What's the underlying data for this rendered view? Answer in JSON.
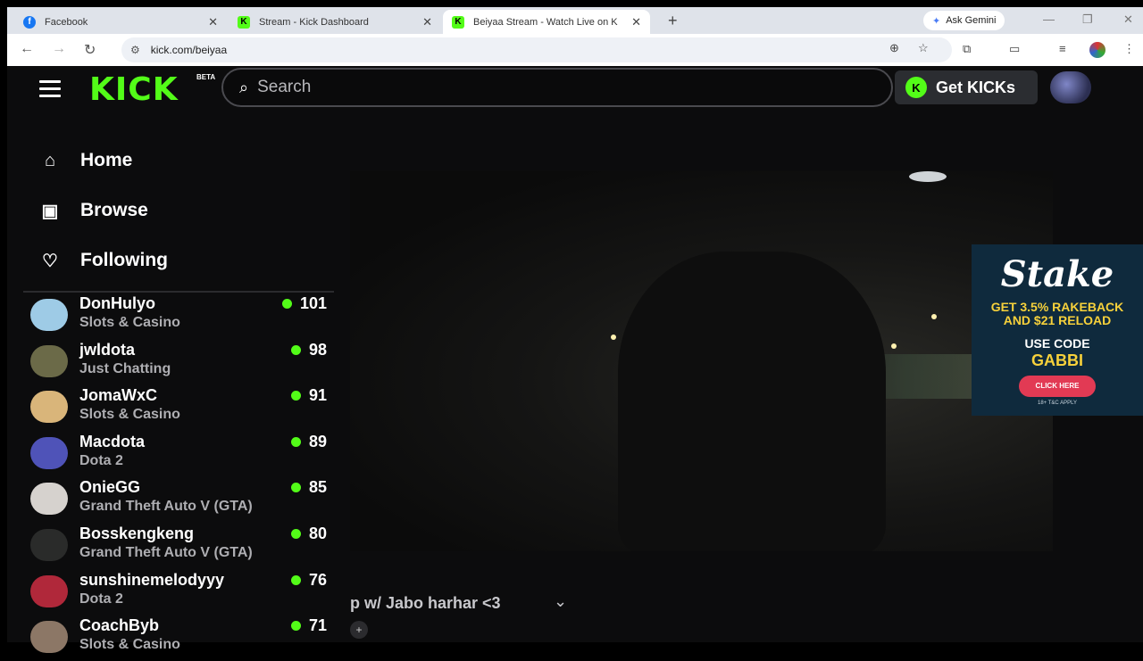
{
  "browser": {
    "tabs": [
      {
        "title": "Facebook",
        "favicon": "facebook-icon",
        "active": false
      },
      {
        "title": "Stream - Kick Dashboard",
        "favicon": "kick-icon",
        "active": false
      },
      {
        "title": "Beiyaa Stream - Watch Live on K",
        "favicon": "kick-icon",
        "active": true
      }
    ],
    "new_tab": "+",
    "gemini_label": "Ask Gemini",
    "url": "kick.com/beiyaa"
  },
  "kick": {
    "logo": "KICK",
    "beta": "BETA",
    "search_placeholder": "Search",
    "get_kicks": "Get KICKs",
    "nav": [
      {
        "label": "Home",
        "icon": "home-icon"
      },
      {
        "label": "Browse",
        "icon": "browse-icon"
      },
      {
        "label": "Following",
        "icon": "heart-icon"
      }
    ],
    "following": [
      {
        "name": "DonHulyo",
        "category": "Slots & Casino",
        "viewers": "101",
        "avatar_color": "#9ecbe6"
      },
      {
        "name": "jwldota",
        "category": "Just Chatting",
        "viewers": "98",
        "avatar_color": "#6b6a48"
      },
      {
        "name": "JomaWxC",
        "category": "Slots & Casino",
        "viewers": "91",
        "avatar_color": "#d9b57a"
      },
      {
        "name": "Macdota",
        "category": "Dota 2",
        "viewers": "89",
        "avatar_color": "#4f53b8"
      },
      {
        "name": "OnieGG",
        "category": "Grand Theft Auto V (GTA)",
        "viewers": "85",
        "avatar_color": "#d6d2ce"
      },
      {
        "name": "Bosskengkeng",
        "category": "Grand Theft Auto V (GTA)",
        "viewers": "80",
        "avatar_color": "#2a2b2a"
      },
      {
        "name": "sunshinemelodyyy",
        "category": "Dota 2",
        "viewers": "76",
        "avatar_color": "#b0283a"
      },
      {
        "name": "CoachByb",
        "category": "Slots & Casino",
        "viewers": "71",
        "avatar_color": "#8c7766"
      }
    ],
    "stream_title": "p w/ Jabo harhar <3"
  },
  "ad": {
    "brand": "Stake",
    "line1a": "GET 3.5% RAKEBACK",
    "line1b": "AND $21 RELOAD",
    "line2": "USE CODE",
    "code": "GABBI",
    "cta": "CLICK HERE",
    "fine": "18+ T&C APPLY"
  },
  "colors": {
    "kick_green": "#53fc18",
    "page_bg": "#0c0c0d"
  }
}
